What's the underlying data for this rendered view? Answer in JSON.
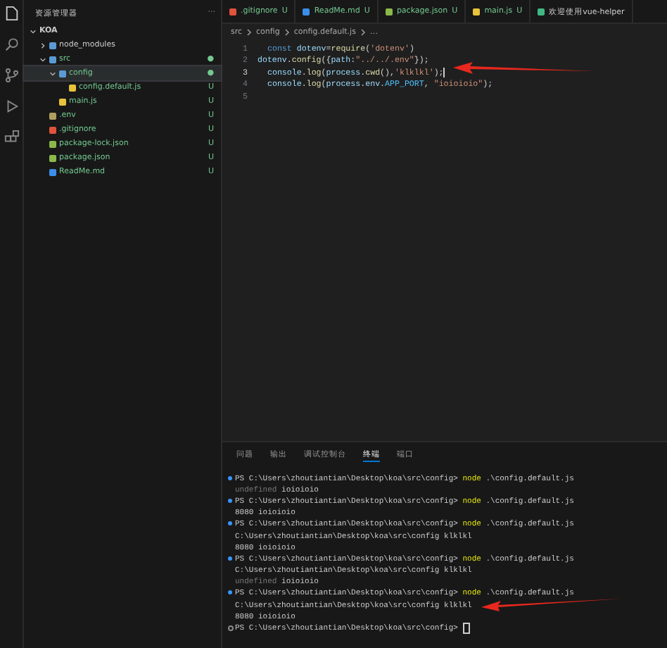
{
  "sidebar": {
    "title": "资源管理器",
    "more": "···",
    "tree": [
      {
        "label": "KOA",
        "kind": "root",
        "expanded": true,
        "children": [
          {
            "label": "node_modules",
            "kind": "folder",
            "expanded": false,
            "selected": false
          },
          {
            "label": "src",
            "kind": "folder",
            "expanded": true,
            "selected": false,
            "status": "●",
            "children": [
              {
                "label": "config",
                "kind": "folder",
                "expanded": true,
                "selected": true,
                "status": "●",
                "children": [
                  {
                    "label": "config.default.js",
                    "kind": "js",
                    "selected": false,
                    "status": "U"
                  }
                ]
              },
              {
                "label": "main.js",
                "kind": "js",
                "selected": false,
                "status": "U"
              }
            ]
          },
          {
            "label": ".env",
            "kind": "env",
            "selected": false,
            "status": "U"
          },
          {
            "label": ".gitignore",
            "kind": "git",
            "selected": false,
            "status": "U"
          },
          {
            "label": "package-lock.json",
            "kind": "json",
            "selected": false,
            "status": "U"
          },
          {
            "label": "package.json",
            "kind": "json",
            "selected": false,
            "status": "U"
          },
          {
            "label": "ReadMe.md",
            "kind": "md",
            "selected": false,
            "status": "U"
          }
        ]
      }
    ]
  },
  "tabs": [
    {
      "label": ".gitignore",
      "kind": "git",
      "status": "U"
    },
    {
      "label": "ReadMe.md",
      "kind": "md",
      "status": "U"
    },
    {
      "label": "package.json",
      "kind": "json",
      "status": "U"
    },
    {
      "label": "main.js",
      "kind": "js",
      "status": "U"
    },
    {
      "label": "欢迎使用vue-helper",
      "kind": "vue"
    }
  ],
  "breadcrumb": [
    "src",
    "config",
    "config.default.js",
    "…"
  ],
  "code": [
    {
      "number": "1",
      "indent": true,
      "tokens": [
        {
          "t": "const",
          "kind": "keyword"
        },
        {
          "t": " dotenv",
          "kind": "variable"
        },
        {
          "t": "=",
          "kind": "punct"
        },
        {
          "t": "require",
          "kind": "function"
        },
        {
          "t": "(",
          "kind": "punct"
        },
        {
          "t": "'dotenv'",
          "kind": "string"
        },
        {
          "t": ")",
          "kind": "punct"
        }
      ]
    },
    {
      "number": "2",
      "indent": false,
      "tokens": [
        {
          "t": "dotenv",
          "kind": "variable"
        },
        {
          "t": ".",
          "kind": "punct"
        },
        {
          "t": "config",
          "kind": "function"
        },
        {
          "t": "({",
          "kind": "punct"
        },
        {
          "t": "path",
          "kind": "variable"
        },
        {
          "t": ":",
          "kind": "punct"
        },
        {
          "t": "\"../../.env\"",
          "kind": "string"
        },
        {
          "t": "});",
          "kind": "punct"
        }
      ]
    },
    {
      "number": "3",
      "indent": true,
      "current": true,
      "tokens": [
        {
          "t": "console",
          "kind": "variable"
        },
        {
          "t": ".",
          "kind": "punct"
        },
        {
          "t": "log",
          "kind": "function"
        },
        {
          "t": "(",
          "kind": "punct"
        },
        {
          "t": "process",
          "kind": "variable"
        },
        {
          "t": ".",
          "kind": "punct"
        },
        {
          "t": "cwd",
          "kind": "function"
        },
        {
          "t": "(),",
          "kind": "punct"
        },
        {
          "t": "'klklkl'",
          "kind": "string"
        },
        {
          "t": ");",
          "kind": "punct"
        }
      ]
    },
    {
      "number": "4",
      "indent": true,
      "current": false,
      "tokens": [
        {
          "t": "console",
          "kind": "variable"
        },
        {
          "t": ".",
          "kind": "punct"
        },
        {
          "t": "log",
          "kind": "function"
        },
        {
          "t": "(",
          "kind": "punct"
        },
        {
          "t": "process",
          "kind": "variable"
        },
        {
          "t": ".",
          "kind": "punct"
        },
        {
          "t": "env",
          "kind": "variable"
        },
        {
          "t": ".",
          "kind": "punct"
        },
        {
          "t": "APP_PORT",
          "kind": "constant"
        },
        {
          "t": ", ",
          "kind": "punct"
        },
        {
          "t": "\"ioioioio\"",
          "kind": "string"
        },
        {
          "t": ");",
          "kind": "punct"
        }
      ]
    },
    {
      "number": "5",
      "current": false
    }
  ],
  "panel_tabs": [
    {
      "label": "问题",
      "selected": false
    },
    {
      "label": "输出",
      "selected": false
    },
    {
      "label": "调试控制台",
      "selected": false
    },
    {
      "label": "终端",
      "selected": true
    },
    {
      "label": "端口",
      "selected": false
    }
  ],
  "terminal": [
    {
      "kind": "prompt",
      "path": "PS C:\\Users\\zhoutiantian\\Desktop\\koa\\src\\config>",
      "cmd": "node",
      "args": ".\\config.default.js"
    },
    {
      "kind": "output",
      "parts": [
        {
          "t": "undefined",
          "dim": true
        },
        {
          "t": "ioioioio",
          "dim": false
        }
      ]
    },
    {
      "kind": "prompt",
      "path": "PS C:\\Users\\zhoutiantian\\Desktop\\koa\\src\\config>",
      "cmd": "node",
      "args": ".\\config.default.js"
    },
    {
      "kind": "output",
      "parts": [
        {
          "t": "8080",
          "dim": false
        },
        {
          "t": "ioioioio",
          "dim": false
        }
      ]
    },
    {
      "kind": "prompt",
      "path": "PS C:\\Users\\zhoutiantian\\Desktop\\koa\\src\\config>",
      "cmd": "node",
      "args": ".\\config.default.js"
    },
    {
      "kind": "output",
      "parts": [
        {
          "t": "C:\\Users\\zhoutiantian\\Desktop\\koa\\src\\config klklkl",
          "dim": false
        }
      ]
    },
    {
      "kind": "output",
      "parts": [
        {
          "t": "8080",
          "dim": false
        },
        {
          "t": "ioioioio",
          "dim": false
        }
      ]
    },
    {
      "kind": "prompt",
      "path": "PS C:\\Users\\zhoutiantian\\Desktop\\koa\\src\\config>",
      "cmd": "node",
      "args": ".\\config.default.js"
    },
    {
      "kind": "output",
      "parts": [
        {
          "t": "C:\\Users\\zhoutiantian\\Desktop\\koa\\src\\config klklkl",
          "dim": false
        }
      ]
    },
    {
      "kind": "output",
      "parts": [
        {
          "t": "undefined",
          "dim": true
        },
        {
          "t": "ioioioio",
          "dim": false
        }
      ]
    },
    {
      "kind": "prompt",
      "path": "PS C:\\Users\\zhoutiantian\\Desktop\\koa\\src\\config>",
      "cmd": "node",
      "args": ".\\config.default.js"
    },
    {
      "kind": "output",
      "parts": [
        {
          "t": "C:\\Users\\zhoutiantian\\Desktop\\koa\\src\\config klklkl",
          "dim": false
        }
      ]
    },
    {
      "kind": "output",
      "parts": [
        {
          "t": "8080",
          "dim": false
        },
        {
          "t": "ioioioio",
          "dim": false
        }
      ]
    },
    {
      "kind": "input",
      "path": "PS C:\\Users\\zhoutiantian\\Desktop\\koa\\src\\config>"
    }
  ]
}
